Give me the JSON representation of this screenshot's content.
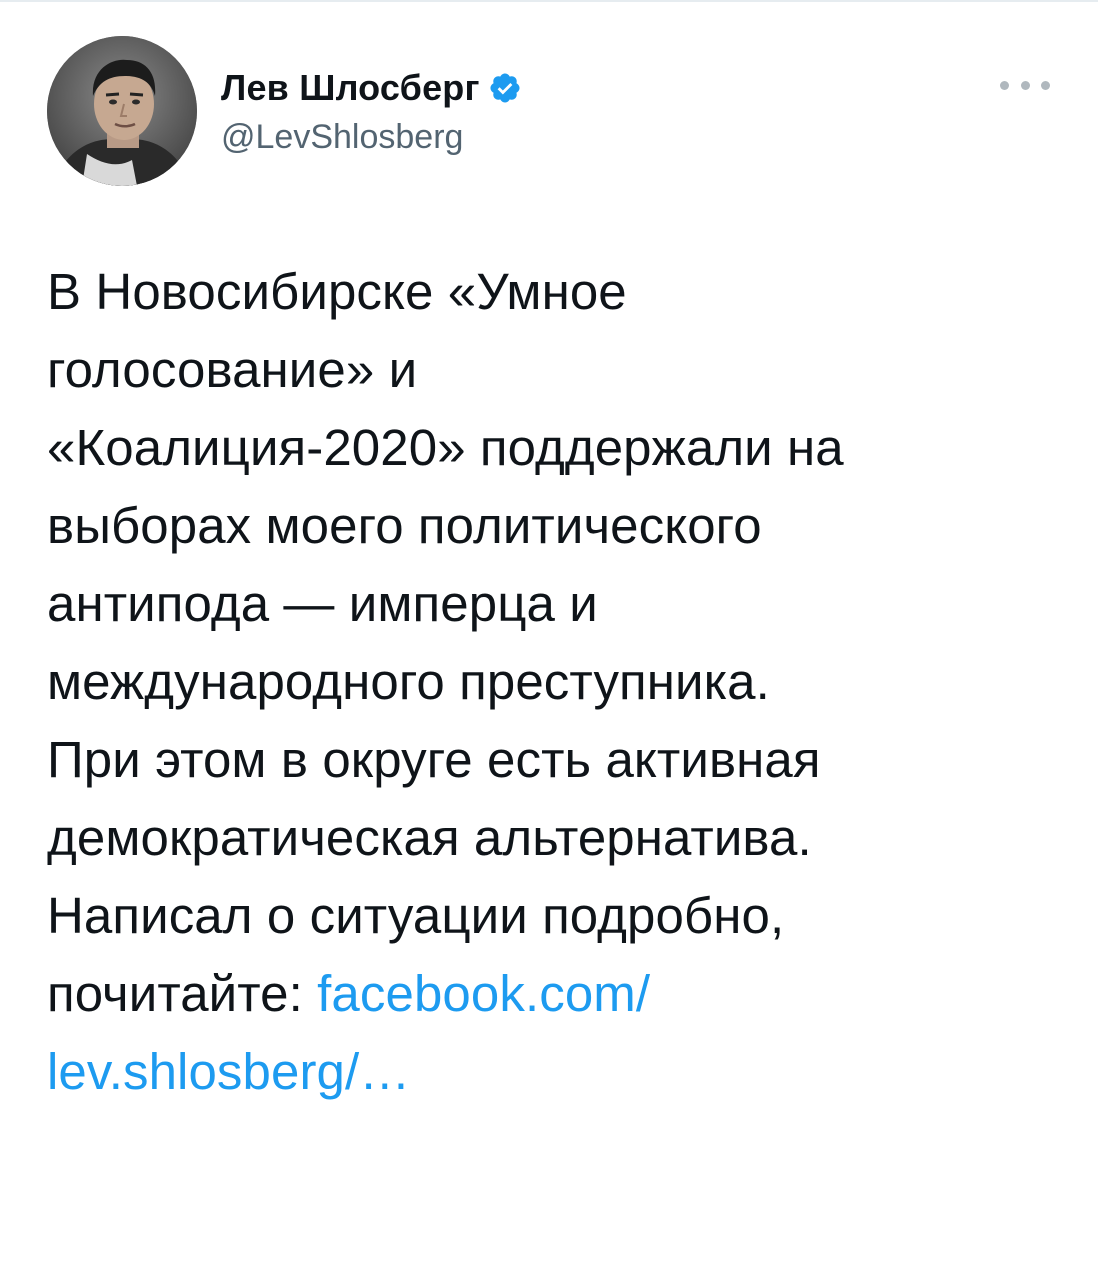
{
  "tweet": {
    "author": {
      "display_name": "Лев Шлосберг",
      "handle": "@LevShlosberg",
      "verified": true,
      "verified_icon": "verified-badge-icon",
      "avatar_icon": "avatar-photo"
    },
    "menu_icon": "more-options-icon",
    "body_lines": [
      "В Новосибирске «Умное",
      "голосование» и",
      "«Коалиция-2020» поддержали на",
      "выборах моего политического",
      "антипода — имперца и",
      "международного преступника.",
      "При этом в округе есть активная",
      "демократическая альтернатива.",
      "Написал о ситуации подробно,"
    ],
    "last_line_prefix": "почитайте: ",
    "link_part_1": "facebook.com/",
    "link_part_2": "lev.shlosberg/…",
    "colors": {
      "text": "#0f1419",
      "secondary": "#536471",
      "link": "#1d9bf0",
      "verified": "#1d9bf0"
    }
  }
}
